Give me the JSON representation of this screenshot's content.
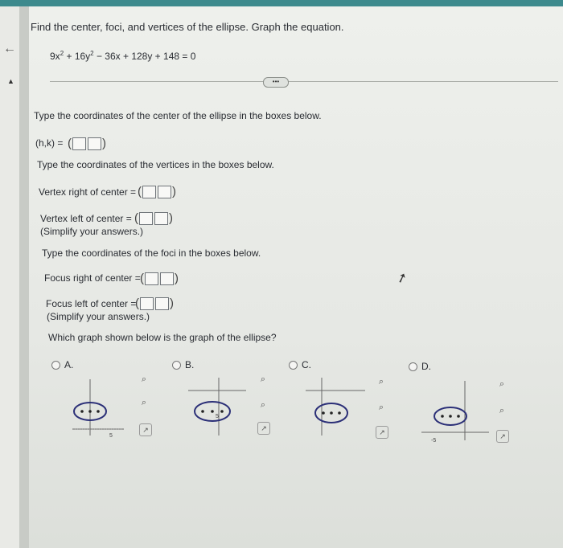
{
  "question": {
    "prompt": "Find the center, foci, and vertices of the ellipse. Graph the equation.",
    "equation_parts": {
      "a": "9x",
      "sup1": "2",
      "b": " + 16y",
      "sup2": "2",
      "c": " − 36x + 128y + 148 = 0"
    }
  },
  "more_button": "•••",
  "center_section": {
    "instruction": "Type the coordinates of the center of the ellipse in the boxes below.",
    "label": "(h,k) ="
  },
  "vertices_section": {
    "instruction": "Type the coordinates of the vertices in the boxes below.",
    "right_label": "Vertex right of center =",
    "left_label": "Vertex left of center =",
    "note": "(Simplify your answers.)"
  },
  "foci_section": {
    "instruction": "Type the coordinates of the foci in the boxes below.",
    "right_label": "Focus right of center =",
    "left_label": "Focus left of center =",
    "note": "(Simplify your answers.)"
  },
  "graph_question": "Which graph shown below is the graph of the ellipse?",
  "options": [
    {
      "label": "A.",
      "axis_label": "5"
    },
    {
      "label": "B.",
      "axis_label": "5"
    },
    {
      "label": "C.",
      "axis_label": ""
    },
    {
      "label": "D.",
      "axis_label": "-5"
    }
  ],
  "icons": {
    "zoom_in": "zoom-in-icon",
    "zoom_out": "zoom-out-icon",
    "open_new": "external-link-icon"
  }
}
